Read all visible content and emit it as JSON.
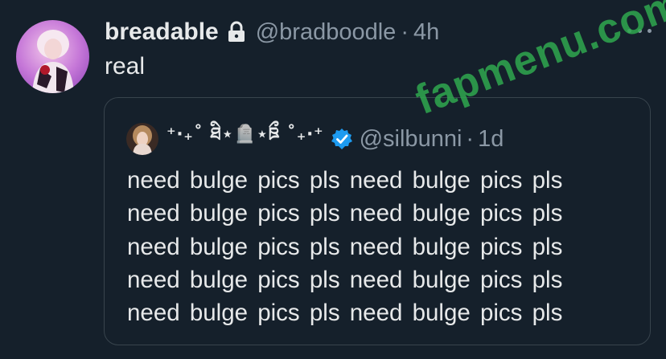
{
  "tweet": {
    "display_name": "breadable",
    "handle": "@bradboodle",
    "separator": "·",
    "time": "4h",
    "text": "real"
  },
  "quoted": {
    "display_name": "⁺‧₊˚ ཐི⋆🪦⋆ཋྀ ˚₊‧⁺",
    "handle": "@silbunni",
    "separator": "·",
    "time": "1d",
    "lines": [
      "need bulge pics pls need bulge pics pls",
      "need bulge pics pls need bulge pics pls",
      "need bulge pics pls need bulge pics pls",
      "need bulge pics pls need bulge pics pls",
      "need bulge pics pls need bulge pics pls"
    ]
  },
  "watermark": "fapmenu.com",
  "colors": {
    "background": "#15202b",
    "text": "#e7e9ea",
    "muted": "#8b98a5",
    "border": "#38444d",
    "verified": "#1d9bf0",
    "watermark": "#2fa84f"
  },
  "icons": {
    "lock": "lock-icon",
    "more": "more-icon",
    "verified": "verified-badge-icon"
  }
}
